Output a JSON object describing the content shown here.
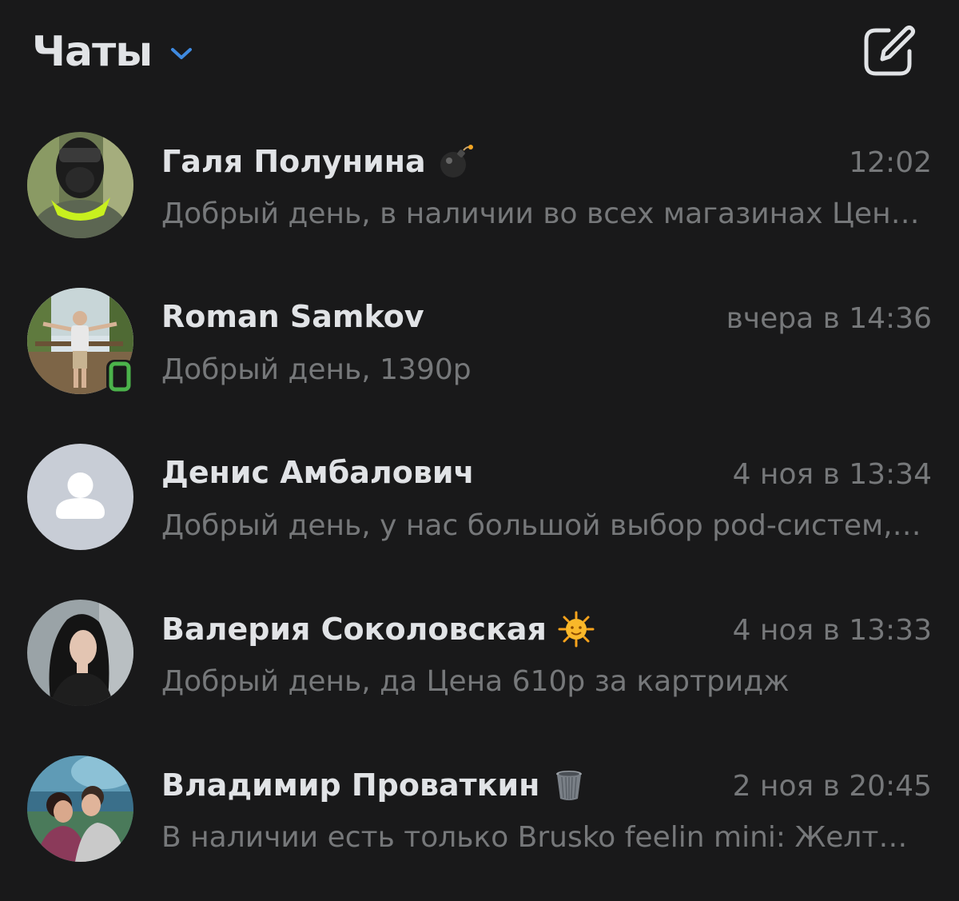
{
  "header": {
    "title": "Чаты",
    "chevron_icon": "chevron-down-icon",
    "compose_icon": "compose-icon",
    "accent_color": "#3f8ae0"
  },
  "chats": [
    {
      "name": "Галя Полунина",
      "name_emoji": "bomb",
      "time": "12:02",
      "preview": "Добрый день, в наличии во всех магазинах Цена:..",
      "online_mobile": false
    },
    {
      "name": "Roman Samkov",
      "name_emoji": "",
      "time": "вчера в 14:36",
      "preview": "Добрый день, 1390р",
      "online_mobile": true
    },
    {
      "name": "Денис Амбалович",
      "name_emoji": "",
      "time": "4 ноя в 13:34",
      "preview": "Добрый день, у нас большой выбор pod-систем, ...",
      "online_mobile": false
    },
    {
      "name": "Валерия Соколовская",
      "name_emoji": "sun-with-face",
      "time": "4 ноя в 13:33",
      "preview": "Добрый день, да Цена 610р за картридж",
      "online_mobile": false
    },
    {
      "name": "Владимир Проваткин",
      "name_emoji": "wastebasket",
      "time": "2 ноя в 20:45",
      "preview": "В наличии есть только Brusko feelin mini: Желтый...",
      "online_mobile": false
    }
  ],
  "colors": {
    "background": "#19191a",
    "primary_text": "#e1e3e6",
    "secondary_text": "#76787a",
    "online": "#4bb34b",
    "placeholder_avatar": "#c8cdd6"
  }
}
